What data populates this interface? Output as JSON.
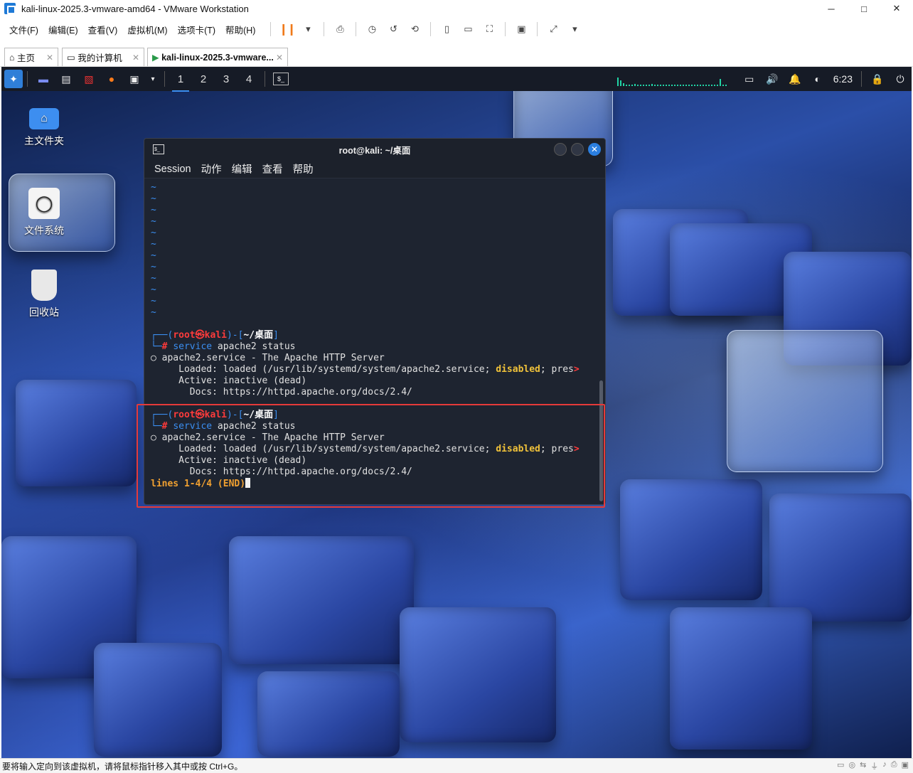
{
  "window": {
    "title": "kali-linux-2025.3-vmware-amd64 - VMware Workstation",
    "minimize": "─",
    "maximize": "□",
    "close": "✕"
  },
  "menu": [
    "文件(F)",
    "编辑(E)",
    "查看(V)",
    "虚拟机(M)",
    "选项卡(T)",
    "帮助(H)"
  ],
  "tabs": [
    {
      "label": "主页",
      "icon": "home-icon"
    },
    {
      "label": "我的计算机",
      "icon": "computer-icon"
    },
    {
      "label": "kali-linux-2025.3-vmware...",
      "icon": "vm-icon"
    }
  ],
  "kali_panel": {
    "workspaces": [
      "1",
      "2",
      "3",
      "4"
    ],
    "active_workspace": "1",
    "clock": "6:23"
  },
  "desktop_icons": [
    {
      "label": "主文件夹",
      "icon": "home-folder-icon"
    },
    {
      "label": "文件系统",
      "icon": "drive-icon"
    },
    {
      "label": "回收站",
      "icon": "trash-icon"
    }
  ],
  "terminal": {
    "title": "root@kali: ~/桌面",
    "menu": [
      "Session",
      "动作",
      "编辑",
      "查看",
      "帮助"
    ],
    "tildes": 12,
    "blocks": [
      {
        "prompt_user": "root㉿kali",
        "prompt_dir": "~/桌面",
        "cmd_keyword": "service",
        "cmd_args": " apache2 status",
        "line1": "○ apache2.service - The Apache HTTP Server",
        "loaded_pre": "     Loaded: loaded (/usr/lib/systemd/system/apache2.service; ",
        "loaded_flag": "disabled",
        "loaded_post": "; pres",
        "active": "     Active: inactive (dead)",
        "docs": "       Docs: https://httpd.apache.org/docs/2.4/"
      },
      {
        "prompt_user": "root㉿kali",
        "prompt_dir": "~/桌面",
        "cmd_keyword": "service",
        "cmd_args": " apache2 status",
        "line1": "○ apache2.service - The Apache HTTP Server",
        "loaded_pre": "     Loaded: loaded (/usr/lib/systemd/system/apache2.service; ",
        "loaded_flag": "disabled",
        "loaded_post": "; pres",
        "active": "     Active: inactive (dead)",
        "docs": "       Docs: https://httpd.apache.org/docs/2.4/"
      }
    ],
    "pager_status": "lines 1-4/4 (END)"
  },
  "statusbar": {
    "text": "要将输入定向到该虚拟机，请将鼠标指针移入其中或按 Ctrl+G。"
  }
}
